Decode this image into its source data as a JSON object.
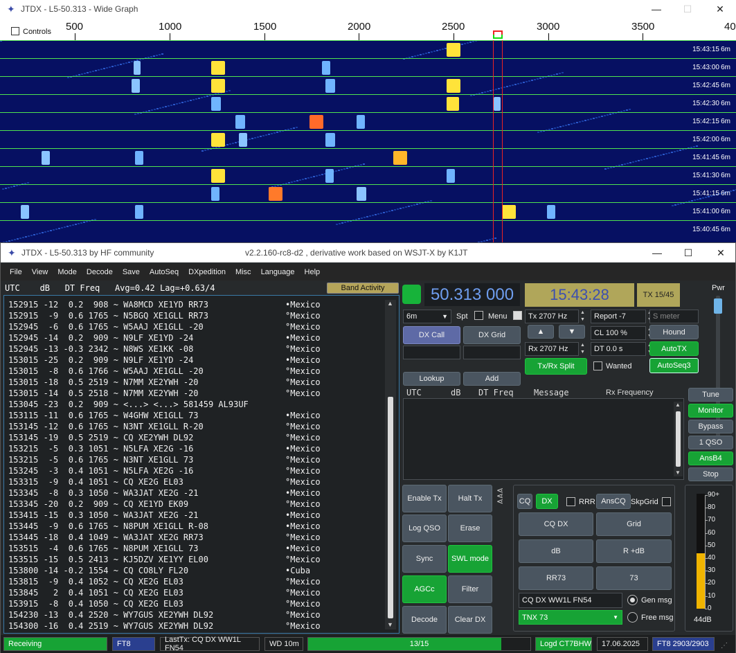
{
  "wide_graph": {
    "title": "JTDX - L5-50.313 - Wide Graph",
    "controls_label": "Controls",
    "freq_ticks": [
      "500",
      "1000",
      "1500",
      "2000",
      "2500",
      "3000",
      "3500",
      "40"
    ],
    "rows": [
      {
        "time": "15:43:15",
        "band": "6m"
      },
      {
        "time": "15:43:00",
        "band": "6m"
      },
      {
        "time": "15:42:45",
        "band": "6m"
      },
      {
        "time": "15:42:30",
        "band": "6m"
      },
      {
        "time": "15:42:15",
        "band": "6m"
      },
      {
        "time": "15:42:00",
        "band": "6m"
      },
      {
        "time": "15:41:45",
        "band": "6m"
      },
      {
        "time": "15:41:30",
        "band": "6m"
      },
      {
        "time": "15:41:15",
        "band": "6m"
      },
      {
        "time": "15:41:00",
        "band": "6m"
      },
      {
        "time": "15:40:45",
        "band": "6m"
      }
    ]
  },
  "main": {
    "title_left": "JTDX - L5-50.313  by HF community",
    "title_right": "v2.2.160-rc8-d2 , derivative work based on WSJT-X by K1JT",
    "menu": [
      "File",
      "View",
      "Mode",
      "Decode",
      "Save",
      "AutoSeq",
      "DXpedition",
      "Misc",
      "Language",
      "Help"
    ],
    "band_header": "UTC    dB   DT Freq   Avg=0.42 Lag=+0.63/4",
    "band_activity_button": "Band Activity",
    "band_rows": [
      {
        "line": "152915 -12  0.2  908 ~ WA8MCD XE1YD RR73",
        "country": "•Mexico"
      },
      {
        "line": "152915  -9  0.6 1765 ~ N5BGQ XE1GLL RR73",
        "country": "°Mexico"
      },
      {
        "line": "152945  -6  0.6 1765 ~ W5AAJ XE1GLL -20",
        "country": "°Mexico"
      },
      {
        "line": "152945 -14  0.2  909 ~ N9LF XE1YD -24",
        "country": "•Mexico"
      },
      {
        "line": "152945 -13 -0.3 2342 ~ N8WS XE1KK -08",
        "country": "°Mexico"
      },
      {
        "line": "153015 -25  0.2  909 ~ N9LF XE1YD -24",
        "country": "•Mexico"
      },
      {
        "line": "153015  -8  0.6 1766 ~ W5AAJ XE1GLL -20",
        "country": "°Mexico"
      },
      {
        "line": "153015 -18  0.5 2519 ~ N7MM XE2YWH -20",
        "country": "°Mexico"
      },
      {
        "line": "153015 -14  0.5 2518 ~ N7MM XE2YWH -20",
        "country": "°Mexico"
      },
      {
        "line": "153045 -23  0.2  909 ~ <...> <...> 581459 AL93UF",
        "country": ""
      },
      {
        "line": "153115 -11  0.6 1765 ~ W4GHW XE1GLL 73",
        "country": "•Mexico"
      },
      {
        "line": "153145 -12  0.6 1765 ~ N3NT XE1GLL R-20",
        "country": "°Mexico"
      },
      {
        "line": "153145 -19  0.5 2519 ~ CQ XE2YWH DL92",
        "country": "°Mexico"
      },
      {
        "line": "153215  -5  0.3 1051 ~ N5LFA XE2G -16",
        "country": "•Mexico"
      },
      {
        "line": "153215  -5  0.6 1765 ~ N3NT XE1GLL 73",
        "country": "°Mexico"
      },
      {
        "line": "153245  -3  0.4 1051 ~ N5LFA XE2G -16",
        "country": "°Mexico"
      },
      {
        "line": "153315  -9  0.4 1051 ~ CQ XE2G EL03",
        "country": "°Mexico"
      },
      {
        "line": "153345  -8  0.3 1050 ~ WA3JAT XE2G -21",
        "country": "•Mexico"
      },
      {
        "line": "153345 -20  0.2  909 ~ CQ XE1YD EK09",
        "country": "°Mexico"
      },
      {
        "line": "153415 -15  0.3 1050 ~ WA3JAT XE2G -21",
        "country": "•Mexico"
      },
      {
        "line": "153445  -9  0.6 1765 ~ N8PUM XE1GLL R-08",
        "country": "•Mexico"
      },
      {
        "line": "153445 -18  0.4 1049 ~ WA3JAT XE2G RR73",
        "country": "°Mexico"
      },
      {
        "line": "153515  -4  0.6 1765 ~ N8PUM XE1GLL 73",
        "country": "•Mexico"
      },
      {
        "line": "153515 -15  0.5 2413 ~ KJ5DZV XE1YY EL00",
        "country": "°Mexico"
      },
      {
        "line": "153800 -14 -0.2 1554 ~ CQ CO8LY FL20",
        "country": "•Cuba"
      },
      {
        "line": "153815  -9  0.4 1052 ~ CQ XE2G EL03",
        "country": "°Mexico"
      },
      {
        "line": "153845   2  0.4 1051 ~ CQ XE2G EL03",
        "country": "°Mexico"
      },
      {
        "line": "153915  -8  0.4 1050 ~ CQ XE2G EL03",
        "country": "°Mexico"
      },
      {
        "line": "154230 -13  0.4 2520 ~ WY7GUS XE2YWH DL92",
        "country": "°Mexico"
      },
      {
        "line": "154300 -16  0.4 2519 ~ WY7GUS XE2YWH DL92",
        "country": "°Mexico"
      }
    ],
    "frequency": "50.313 000",
    "clock": "15:43:28",
    "tx_period": "TX 15/45",
    "pwr_label": "Pwr",
    "band_select": "6m",
    "spt": "Spt",
    "menu_chk": "Menu",
    "tx_freq": "Tx  2707  Hz",
    "rx_freq": "Rx  2707  Hz",
    "report": "Report -7",
    "smeter": "S meter",
    "cl": "CL  100 %",
    "dt": "DT 0.0 s",
    "hound": "Hound",
    "autotx": "AutoTX",
    "autoseq": "AutoSeq3",
    "txrx_split": "Tx/Rx Split",
    "wanted": "Wanted",
    "dx_call": "DX Call",
    "dx_grid": "DX Grid",
    "lookup": "Lookup",
    "add": "Add",
    "rx_header_utc": "UTC",
    "rx_header_db": "dB",
    "rx_header_dt": "DT Freq",
    "rx_header_msg": "Message",
    "rx_header_rf": "Rx Frequency",
    "side_buttons": [
      "Tune",
      "Monitor",
      "Bypass",
      "1 QSO",
      "AnsB4",
      "Stop"
    ],
    "btn_enable_tx": "Enable Tx",
    "btn_halt_tx": "Halt Tx",
    "btn_log_qso": "Log QSO",
    "btn_erase": "Erase",
    "btn_sync": "Sync",
    "btn_swl": "SWL mode",
    "btn_agcc": "AGCc",
    "btn_filter": "Filter",
    "btn_decode": "Decode",
    "btn_clear_dx": "Clear DX",
    "cq": "CQ",
    "dx": "DX",
    "rrr": "RRR",
    "anscq": "AnsCQ",
    "skpgrid": "SkpGrid",
    "msg_buttons": [
      "CQ DX",
      "Grid",
      "dB",
      "R +dB",
      "RR73",
      "73"
    ],
    "gen_msg_text": "CQ DX WW1L FN54",
    "gen_msg": "Gen msg",
    "free_msg_text": "TNX 73",
    "free_msg": "Free msg",
    "meter_scale": [
      "90+",
      "80",
      "70",
      "60",
      "50",
      "40",
      "30",
      "20",
      "10",
      "0"
    ],
    "meter_level_db": 44,
    "meter_value": "44dB",
    "status": {
      "receiving": "Receiving",
      "mode": "FT8",
      "last_tx": "LastTx: CQ DX WW1L FN54",
      "wd": "WD 10m",
      "progress_text": "13/15",
      "progress_fraction": 0.87,
      "logd": "Logd CT7BHW",
      "date": "17.06.2025",
      "ft8_count": "FT8  2903/2903"
    }
  }
}
